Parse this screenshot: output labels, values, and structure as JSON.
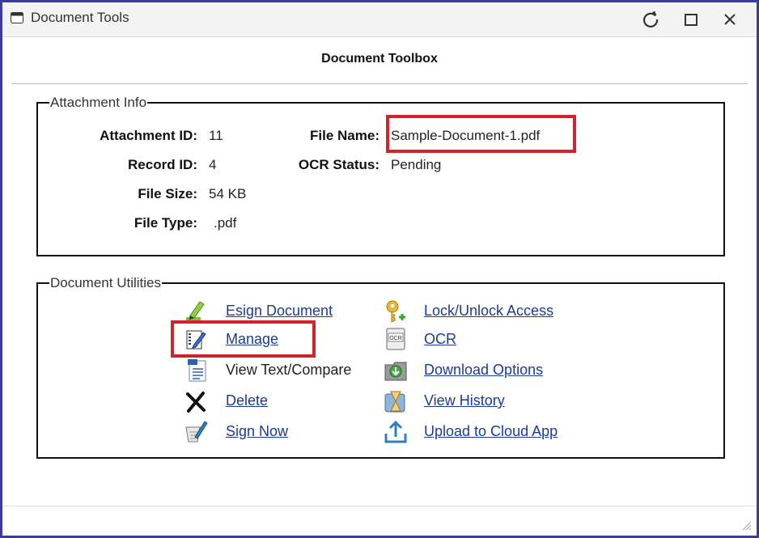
{
  "window": {
    "title": "Document Tools"
  },
  "heading": "Document Toolbox",
  "attachment_info": {
    "legend": "Attachment Info",
    "fields": [
      {
        "label": "Attachment ID:",
        "value": "11"
      },
      {
        "label": "Record ID:",
        "value": "4"
      },
      {
        "label": "File Size:",
        "value": "54 KB"
      },
      {
        "label": "File Type:",
        "value": ".pdf"
      },
      {
        "label": "File Name:",
        "value": "Sample-Document-1.pdf"
      },
      {
        "label": "OCR Status:",
        "value": "Pending"
      }
    ]
  },
  "utilities": {
    "legend": "Document Utilities",
    "items": [
      {
        "label": "Esign Document",
        "icon": "esign-pencil-icon"
      },
      {
        "label": "Manage",
        "icon": "notebook-pencil-icon"
      },
      {
        "label": "View Text/Compare",
        "icon": "text-document-icon"
      },
      {
        "label": "Delete",
        "icon": "delete-x-icon"
      },
      {
        "label": "Sign Now",
        "icon": "sign-pen-icon"
      },
      {
        "label": "Lock/Unlock Access",
        "icon": "key-icon"
      },
      {
        "label": "OCR",
        "icon": "ocr-scan-icon"
      },
      {
        "label": "Download Options",
        "icon": "download-folder-icon"
      },
      {
        "label": "View History",
        "icon": "hourglass-history-icon"
      },
      {
        "label": "Upload to Cloud App",
        "icon": "upload-arrow-icon"
      }
    ]
  },
  "colors": {
    "highlight": "#d0232b",
    "link": "#1a3a96",
    "frame": "#3b3c96"
  }
}
